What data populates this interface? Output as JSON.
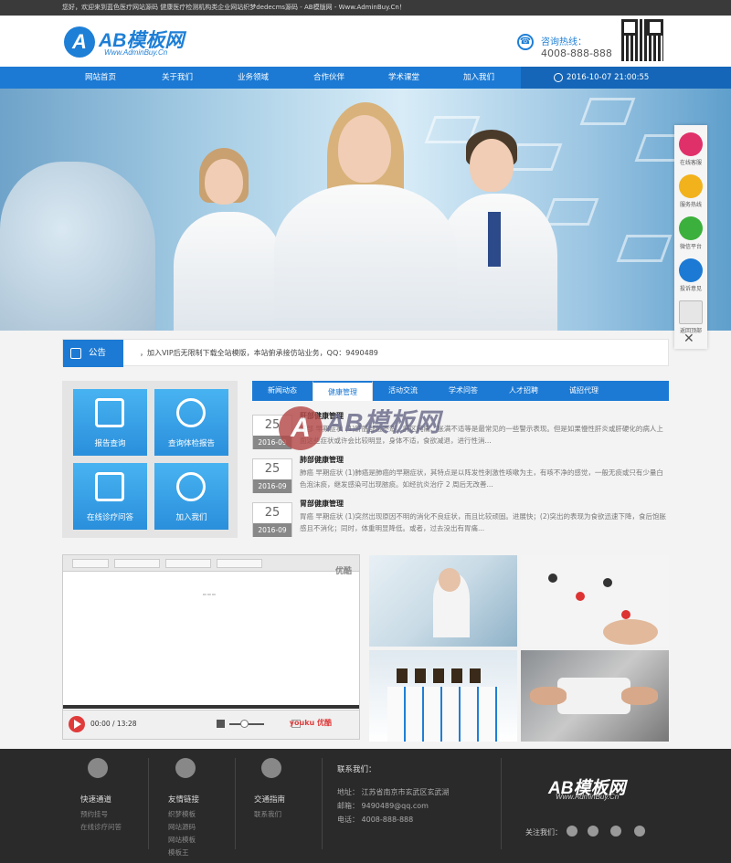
{
  "topbar": {
    "text": "您好，欢迎来到蓝色医疗网站源码 健康医疗检测机构类企业网站织梦dedecms源码 - AB模版网 - Www.AdminBuy.Cn！"
  },
  "header": {
    "logo_letter": "A",
    "logo_name": "AB模板网",
    "logo_url": "Www.AdminBuy.Cn",
    "hotline_label": "咨询热线：",
    "hotline_number": "4008-888-888"
  },
  "nav": {
    "items": [
      "网站首页",
      "关于我们",
      "业务领域",
      "合作伙伴",
      "学术课堂",
      "加入我们"
    ],
    "datetime": "2016-10-07 21:00:55"
  },
  "notice": {
    "label": "公告",
    "text": "，加入VIP后无限制下载全站模版，本站俯承接仿站业务，QQ：9490489"
  },
  "quick": {
    "items": [
      "报告查询",
      "查询体检报告",
      "在线诊疗问答",
      "加入我们"
    ]
  },
  "tabs": {
    "items": [
      "新闻动态",
      "健康管理",
      "活动交流",
      "学术问答",
      "人才招聘",
      "诚招代理"
    ],
    "active": 1
  },
  "news": [
    {
      "day": "25",
      "ym": "2016-09",
      "title": "肝部健康管理",
      "desc": "肝部 早期症状 (1)肝脏部位不适，肝区钝痛、胀满不适等是最常见的一些警示表现。但是如果慢性肝炎或肝硬化的病人上面这些症状或许会比较明显，身体不适，食欲减退，进行性消..."
    },
    {
      "day": "25",
      "ym": "2016-09",
      "title": "肺部健康管理",
      "desc": "肺癌 早期症状 (1)肺癌是肺癌的早期症状，其特点是以阵发性刺激性咳嗽为主，有咳不净的感觉，一般无痰或只有少量白色泡沫痰，继发感染可出现脓痰。如经抗炎治疗 2 周后无改善..."
    },
    {
      "day": "25",
      "ym": "2016-09",
      "title": "胃部健康管理",
      "desc": "胃癌 早期症状 (1)突然出现原因不明的消化不良症状，而且比较顽固。进展快；(2)突出的表现为食欲迅速下降，食后饱胀感且不消化；同时，体重明显降低。或者，过去没出有胃痛..."
    }
  ],
  "watermark": {
    "letter": "A",
    "name": "AB模板网"
  },
  "video": {
    "brand": "优酷",
    "time": "00:00 / 13:28",
    "ybrand": "youku 优酷"
  },
  "footer": {
    "cols": [
      {
        "head": "快速通道",
        "links": [
          "预约挂号",
          "在线诊疗问答"
        ]
      },
      {
        "head": "友情链接",
        "links": [
          "织梦模板",
          "网站源码",
          "网站模板",
          "模板王"
        ]
      },
      {
        "head": "交通指南",
        "links": [
          "联系我们"
        ]
      }
    ],
    "contact_head": "联系我们：",
    "address": "地址： 江苏省南京市玄武区玄武湖",
    "email": "邮箱： 9490489@qq.com",
    "phone": "电话： 4008-888-888",
    "logo_name": "AB模板网",
    "logo_url": "Www.AdminBuy.Cn",
    "follow": "关注我们："
  },
  "sidebar": {
    "items": [
      "在线客服",
      "服务热线",
      "微信平台",
      "投诉意见",
      "返回顶部"
    ]
  },
  "colors": {
    "primary": "#1c7ad4",
    "footer": "#2a2a2a",
    "accent_red": "#e03b3b"
  }
}
